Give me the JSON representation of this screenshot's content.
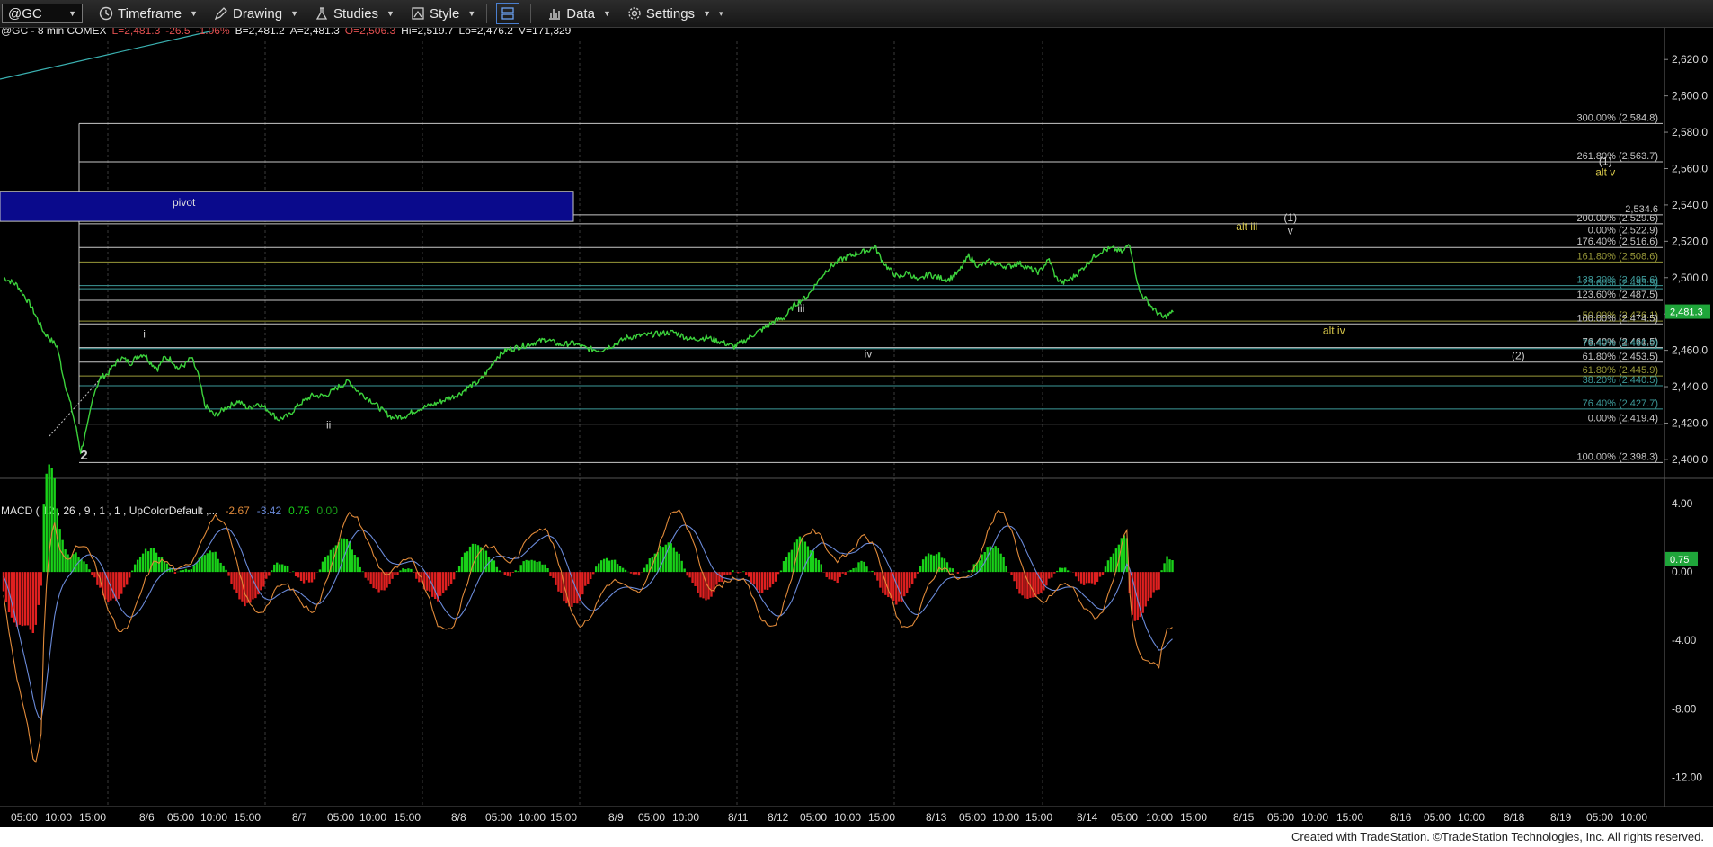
{
  "toolbar": {
    "symbol": "@GC",
    "timeframe": "Timeframe",
    "drawing": "Drawing",
    "studies": "Studies",
    "style": "Style",
    "data": "Data",
    "settings": "Settings"
  },
  "header": {
    "symbol_info": "@GC - 8 min  COMEX",
    "last": "L=2,481.3",
    "change": "-26.5",
    "change_pct": "-1.06%",
    "bid": "B=2,481.2",
    "ask": "A=2,481.3",
    "open": "O=2,506.3",
    "high": "Hi=2,519.7",
    "low": "Lo=2,476.2",
    "volume": "V=171,329"
  },
  "colors": {
    "price_line": "#3cd23c",
    "last_price_box": "#1fa53a",
    "pivot_box": "#0a0a8c",
    "fib_white": "#c8c8c8",
    "fib_olive": "#9a9a3a",
    "fib_teal": "#3d9a9a",
    "macd_up": "#19d219",
    "macd_down": "#e02020",
    "macd_line": "#e08a3a",
    "signal_line": "#6a8ad8",
    "wave_label_white": "#d0d0d0",
    "wave_label_yellow": "#d8c84a"
  },
  "chart_data": [
    {
      "type": "line",
      "title": "@GC - 8 min  COMEX",
      "ylim": [
        2395,
        2630
      ],
      "y_ticks": [
        "2,620.0",
        "2,600.0",
        "2,580.0",
        "2,560.0",
        "2,540.0",
        "2,520.0",
        "2,500.0",
        "2,480.0",
        "2,460.0",
        "2,440.0",
        "2,420.0",
        "2,400.0"
      ],
      "last_price": "2,481.3",
      "x_ticks": [
        "05:00",
        "10:00",
        "15:00",
        "8/6",
        "05:00",
        "10:00",
        "15:00",
        "8/7",
        "05:00",
        "10:00",
        "15:00",
        "8/8",
        "05:00",
        "10:00",
        "15:00",
        "8/9",
        "05:00",
        "10:00",
        "8/11",
        "8/12",
        "05:00",
        "10:00",
        "15:00",
        "8/13",
        "05:00",
        "10:00",
        "15:00",
        "8/14",
        "05:00",
        "10:00",
        "15:00",
        "8/15",
        "05:00",
        "10:00",
        "15:00",
        "8/16",
        "05:00",
        "10:00",
        "8/18",
        "8/19",
        "05:00",
        "10:00"
      ],
      "series": [
        {
          "values": [
            [
              0,
              2500
            ],
            [
              4,
              2496
            ],
            [
              8,
              2485
            ],
            [
              12,
              2470
            ],
            [
              16,
              2462
            ],
            [
              18,
              2444
            ],
            [
              20,
              2430
            ],
            [
              22,
              2414
            ],
            [
              23,
              2404
            ],
            [
              25,
              2418
            ],
            [
              27,
              2437
            ],
            [
              29,
              2445
            ],
            [
              31,
              2447
            ],
            [
              33,
              2452
            ],
            [
              35,
              2456
            ],
            [
              38,
              2453
            ],
            [
              40,
              2457
            ],
            [
              42,
              2458
            ],
            [
              44,
              2453
            ],
            [
              46,
              2450
            ],
            [
              48,
              2456
            ],
            [
              50,
              2455
            ],
            [
              52,
              2450
            ],
            [
              54,
              2452
            ],
            [
              56,
              2456
            ],
            [
              58,
              2447
            ],
            [
              60,
              2430
            ],
            [
              63,
              2424
            ],
            [
              66,
              2428
            ],
            [
              70,
              2432
            ],
            [
              73,
              2428
            ],
            [
              76,
              2431
            ],
            [
              79,
              2427
            ],
            [
              82,
              2422
            ],
            [
              85,
              2424
            ],
            [
              88,
              2430
            ],
            [
              92,
              2435
            ],
            [
              96,
              2435
            ],
            [
              100,
              2440
            ],
            [
              103,
              2443
            ],
            [
              106,
              2437
            ],
            [
              110,
              2432
            ],
            [
              113,
              2427
            ],
            [
              116,
              2423
            ],
            [
              120,
              2424
            ],
            [
              124,
              2428
            ],
            [
              128,
              2430
            ],
            [
              132,
              2433
            ],
            [
              136,
              2436
            ],
            [
              139,
              2440
            ],
            [
              142,
              2443
            ],
            [
              145,
              2450
            ],
            [
              147,
              2456
            ],
            [
              150,
              2460
            ],
            [
              154,
              2462
            ],
            [
              158,
              2464
            ],
            [
              162,
              2466
            ],
            [
              166,
              2463
            ],
            [
              170,
              2464
            ],
            [
              174,
              2461
            ],
            [
              178,
              2460
            ],
            [
              182,
              2463
            ],
            [
              186,
              2467
            ],
            [
              190,
              2468
            ],
            [
              195,
              2469
            ],
            [
              200,
              2470
            ],
            [
              205,
              2466
            ],
            [
              210,
              2467
            ],
            [
              215,
              2464
            ],
            [
              218,
              2462
            ],
            [
              221,
              2465
            ],
            [
              224,
              2469
            ],
            [
              227,
              2472
            ],
            [
              230,
              2476
            ],
            [
              233,
              2478
            ],
            [
              236,
              2485
            ],
            [
              240,
              2490
            ],
            [
              243,
              2498
            ],
            [
              246,
              2505
            ],
            [
              250,
              2510
            ],
            [
              254,
              2513
            ],
            [
              258,
              2515
            ],
            [
              260,
              2517
            ],
            [
              262,
              2510
            ],
            [
              264,
              2505
            ],
            [
              267,
              2500
            ],
            [
              270,
              2503
            ],
            [
              273,
              2498
            ],
            [
              276,
              2502
            ],
            [
              279,
              2500
            ],
            [
              282,
              2499
            ],
            [
              285,
              2503
            ],
            [
              288,
              2512
            ],
            [
              291,
              2506
            ],
            [
              294,
              2509
            ],
            [
              297,
              2507
            ],
            [
              300,
              2506
            ],
            [
              303,
              2508
            ],
            [
              306,
              2505
            ],
            [
              309,
              2503
            ],
            [
              312,
              2510
            ],
            [
              314,
              2500
            ],
            [
              316,
              2497
            ],
            [
              319,
              2500
            ],
            [
              322,
              2505
            ],
            [
              325,
              2511
            ],
            [
              328,
              2515
            ],
            [
              331,
              2516
            ],
            [
              334,
              2514
            ],
            [
              336,
              2519
            ],
            [
              337,
              2510
            ],
            [
              339,
              2492
            ],
            [
              341,
              2488
            ],
            [
              343,
              2483
            ],
            [
              346,
              2478
            ],
            [
              349,
              2481
            ]
          ]
        }
      ],
      "fib_levels": [
        {
          "label": "300.00% (2,584.8)",
          "value": 2584.8,
          "color": "white"
        },
        {
          "label": "261.80% (2,563.7)",
          "value": 2563.7,
          "color": "white"
        },
        {
          "label": "2,534.6",
          "value": 2534.6,
          "color": "white"
        },
        {
          "label": "200.00% (2,529.6)",
          "value": 2529.6,
          "color": "white"
        },
        {
          "label": "0.00% (2,522.9)",
          "value": 2522.9,
          "color": "white"
        },
        {
          "label": "176.40% (2,516.6)",
          "value": 2516.6,
          "color": "white"
        },
        {
          "label": "161.80% (2,508.6)",
          "value": 2508.6,
          "color": "olive"
        },
        {
          "label": "138.20% (2,495.6)",
          "value": 2495.6,
          "color": "teal"
        },
        {
          "label": "23.60% (2,493.9)",
          "value": 2493.9,
          "color": "teal"
        },
        {
          "label": "123.60% (2,487.5)",
          "value": 2487.5,
          "color": "white"
        },
        {
          "label": "50.00% (2,476.1)",
          "value": 2476.1,
          "color": "olive"
        },
        {
          "label": "100.00% (2,474.5)",
          "value": 2474.5,
          "color": "white"
        },
        {
          "label": "76.40% (2,461.5)",
          "value": 2461.5,
          "color": "white"
        },
        {
          "label": "76.40% (2,460.9)",
          "value": 2460.9,
          "color": "teal"
        },
        {
          "label": "61.80% (2,453.5)",
          "value": 2453.5,
          "color": "white"
        },
        {
          "label": "61.80% (2,445.9)",
          "value": 2445.9,
          "color": "olive"
        },
        {
          "label": "38.20% (2,440.5)",
          "value": 2440.5,
          "color": "teal"
        },
        {
          "label": "76.40% (2,427.7)",
          "value": 2427.7,
          "color": "teal"
        },
        {
          "label": "0.00% (2,419.4)",
          "value": 2419.4,
          "color": "white"
        },
        {
          "label": "100.00% (2,398.3)",
          "value": 2398.3,
          "color": "white"
        }
      ],
      "pivot": {
        "label": "pivot",
        "top": 2547.5,
        "bottom": 2531
      },
      "wave_labels": [
        {
          "text": "2",
          "x": 24,
          "y": 2400,
          "color": "white"
        },
        {
          "text": "i",
          "x": 42,
          "y": 2467,
          "color": "white"
        },
        {
          "text": "ii",
          "x": 97,
          "y": 2417,
          "color": "white"
        },
        {
          "text": "iii",
          "x": 238,
          "y": 2481,
          "color": "white"
        },
        {
          "text": "iv",
          "x": 258,
          "y": 2456,
          "color": "white"
        },
        {
          "text": "alt iii",
          "x": 371,
          "y": 2526,
          "color": "yellow"
        },
        {
          "text": "(1)",
          "x": 384,
          "y": 2531,
          "color": "white"
        },
        {
          "text": "v",
          "x": 384,
          "y": 2524,
          "color": "white"
        },
        {
          "text": "alt iv",
          "x": 397,
          "y": 2469,
          "color": "yellow"
        },
        {
          "text": "(2)",
          "x": 452,
          "y": 2455,
          "color": "white"
        },
        {
          "text": "(1)",
          "x": 478,
          "y": 2562,
          "color": "white"
        },
        {
          "text": "alt v",
          "x": 478,
          "y": 2556,
          "color": "yellow"
        }
      ]
    },
    {
      "type": "bar",
      "title": "MACD ( 12 , 26 , 9 , 1 , 1 , UpColorDefault ,...",
      "indicator_values": [
        "-2.67",
        "-3.42",
        "0.75",
        "0.00"
      ],
      "ylim": [
        -13.5,
        5
      ],
      "y_ticks": [
        "4.00",
        "0.00",
        "-4.00",
        "-8.00",
        "-12.00"
      ],
      "last_value": "0.75"
    }
  ],
  "footer": "Created with TradeStation. ©TradeStation Technologies, Inc. All rights reserved."
}
